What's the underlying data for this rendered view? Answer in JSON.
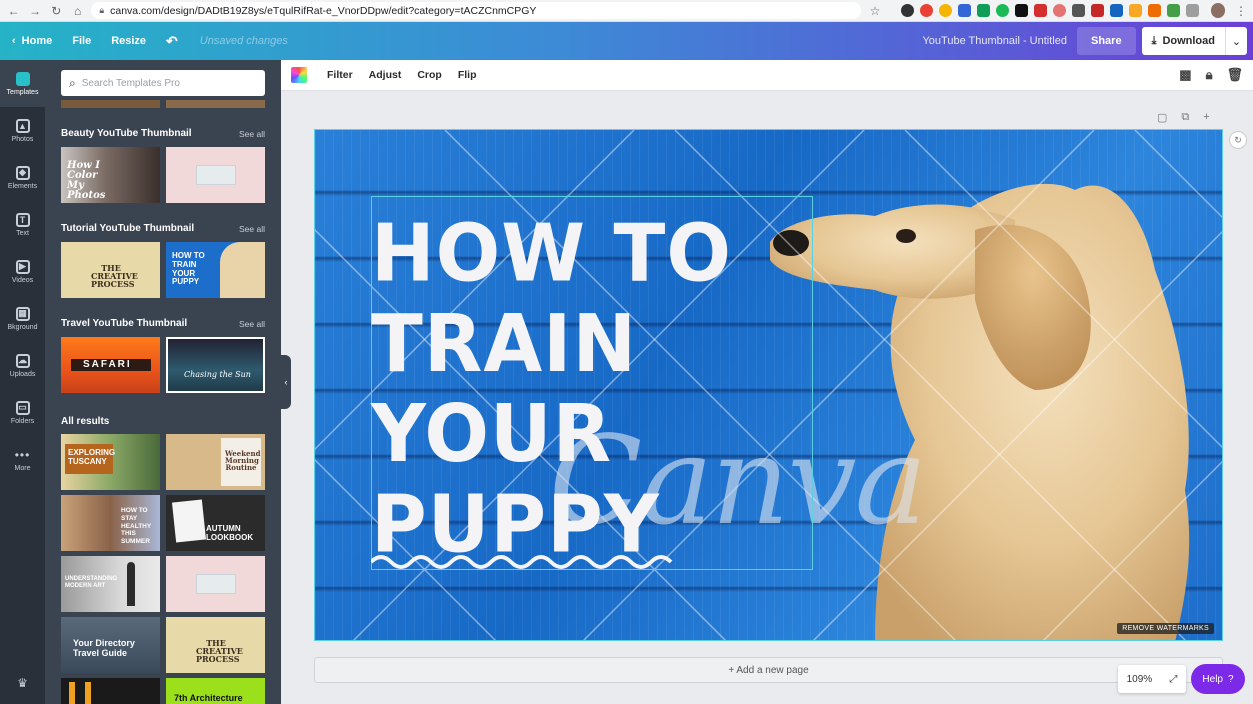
{
  "browser": {
    "url": "canva.com/design/DADtB19Z8ys/eTqulRifRat-e_VnorDDpw/edit?category=tACZCnmCPGY"
  },
  "topbar": {
    "home_label": "Home",
    "file_label": "File",
    "resize_label": "Resize",
    "unsaved_label": "Unsaved changes",
    "doc_title": "YouTube Thumbnail - Untitled",
    "share_label": "Share",
    "download_label": "Download"
  },
  "rail": {
    "items": [
      {
        "label": "Templates",
        "icon": "templates-icon"
      },
      {
        "label": "Photos",
        "icon": "photos-icon"
      },
      {
        "label": "Elements",
        "icon": "elements-icon"
      },
      {
        "label": "Text",
        "icon": "text-icon"
      },
      {
        "label": "Videos",
        "icon": "videos-icon"
      },
      {
        "label": "Bkground",
        "icon": "background-icon"
      },
      {
        "label": "Uploads",
        "icon": "uploads-icon"
      },
      {
        "label": "Folders",
        "icon": "folders-icon"
      },
      {
        "label": "More",
        "icon": "more-icon"
      }
    ]
  },
  "panel": {
    "search_placeholder": "Search Templates Pro",
    "see_all": "See all",
    "sections": [
      {
        "title": "Beauty YouTube Thumbnail"
      },
      {
        "title": "Tutorial YouTube Thumbnail"
      },
      {
        "title": "Travel YouTube Thumbnail"
      },
      {
        "title": "All results"
      }
    ],
    "thumbs": {
      "beauty_1": "How I Color My Photos",
      "tutorial_1_a": "THE",
      "tutorial_1_b": "CREATIVE",
      "tutorial_1_c": "PROCESS",
      "tutorial_2": "HOW TO TRAIN YOUR PUPPY",
      "travel_1": "SAFARI",
      "travel_2": "Chasing the Sun",
      "all_1_a": "EXPLORING",
      "all_1_b": "TUSCANY",
      "all_2": "Weekend Morning Routine",
      "all_3": "HOW TO STAY HEALTHY THIS SUMMER",
      "all_4_a": "AUTUMN",
      "all_4_b": "LOOKBOOK",
      "all_5": "UNDERSTANDING MODERN ART",
      "all_7": "Your Directory Travel Guide",
      "all_8_a": "THE",
      "all_8_b": "CREATIVE",
      "all_8_c": "PROCESS",
      "all_10": "7th Architecture"
    }
  },
  "toolbar": {
    "filter": "Filter",
    "adjust": "Adjust",
    "crop": "Crop",
    "flip": "Flip"
  },
  "design": {
    "headline": [
      "HOW TO",
      "TRAIN",
      "YOUR",
      "PUPPY"
    ],
    "watermark_word": "Canva",
    "remove_watermarks": "REMOVE WATERMARKS"
  },
  "footer": {
    "add_page": "+ Add a new page",
    "zoom": "109%",
    "help": "Help"
  },
  "colors": {
    "brand_gradient_start": "#25b3c7",
    "brand_gradient_end": "#6b3fd6",
    "help_purple": "#7d2ae8",
    "panel_bg": "#3a4350",
    "rail_bg": "#293039"
  }
}
